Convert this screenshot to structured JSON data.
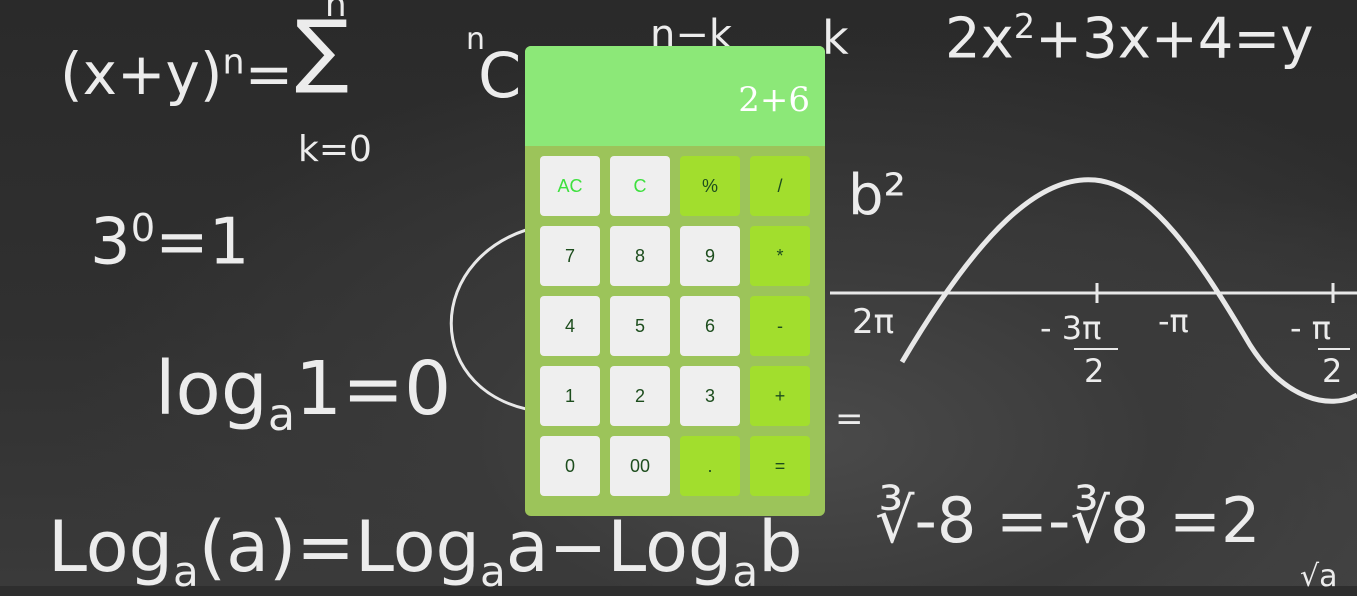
{
  "display": {
    "expression": "2+6"
  },
  "keypad": {
    "rows": [
      [
        {
          "label": "AC",
          "kind": "clear"
        },
        {
          "label": "C",
          "kind": "clear"
        },
        {
          "label": "%",
          "kind": "op"
        },
        {
          "label": "/",
          "kind": "op"
        }
      ],
      [
        {
          "label": "7",
          "kind": "num"
        },
        {
          "label": "8",
          "kind": "num"
        },
        {
          "label": "9",
          "kind": "num"
        },
        {
          "label": "*",
          "kind": "op"
        }
      ],
      [
        {
          "label": "4",
          "kind": "num"
        },
        {
          "label": "5",
          "kind": "num"
        },
        {
          "label": "6",
          "kind": "num"
        },
        {
          "label": "-",
          "kind": "op"
        }
      ],
      [
        {
          "label": "1",
          "kind": "num"
        },
        {
          "label": "2",
          "kind": "num"
        },
        {
          "label": "3",
          "kind": "num"
        },
        {
          "label": "+",
          "kind": "op"
        }
      ],
      [
        {
          "label": "0",
          "kind": "num"
        },
        {
          "label": "00",
          "kind": "num"
        },
        {
          "label": ".",
          "kind": "op"
        },
        {
          "label": "=",
          "kind": "op"
        }
      ]
    ]
  },
  "background": {
    "formulas": {
      "f1": "(x+y)",
      "f1_exp": "n",
      "f1_eq": "=",
      "sigma": "∑",
      "sigma_top": "n",
      "sigma_bottom": "k=0",
      "c_sup": "n",
      "c_letter": "C",
      "nk": "n−k",
      "k": "k",
      "f2_a": "2x",
      "f2_sup": "2",
      "f2_b": "+3x+4=y",
      "f3_base": "3",
      "f3_sup": "0",
      "f3_rest": "=1",
      "f4_log": "log",
      "f4_sub": "a",
      "f4_rest": "1=0",
      "b2": "b²",
      "eq_tail": "=",
      "ax_2pi": "2π",
      "ax_m3pi": "- 3π",
      "ax_2a": "2",
      "ax_mpi": "-π",
      "ax_mpi2": "- π",
      "ax_2b": "2",
      "f5": "∛-8 =-∛8 =2",
      "f6": "Log",
      "f6_sub": "a",
      "f6_frac": "(a",
      "f6_rest": ")=Log",
      "f6_sub2": "a",
      "f6_rest2": "a−Log",
      "f6_sub3": "a",
      "f6_rest3": "b",
      "corner": "√a"
    }
  },
  "colors": {
    "chalk": "#ececec",
    "calc_body": "#9cc45a",
    "display_bg": "#8ce878",
    "num_key": "#efefef",
    "op_key": "#a2de2d",
    "clear_text": "#3ee03e"
  }
}
